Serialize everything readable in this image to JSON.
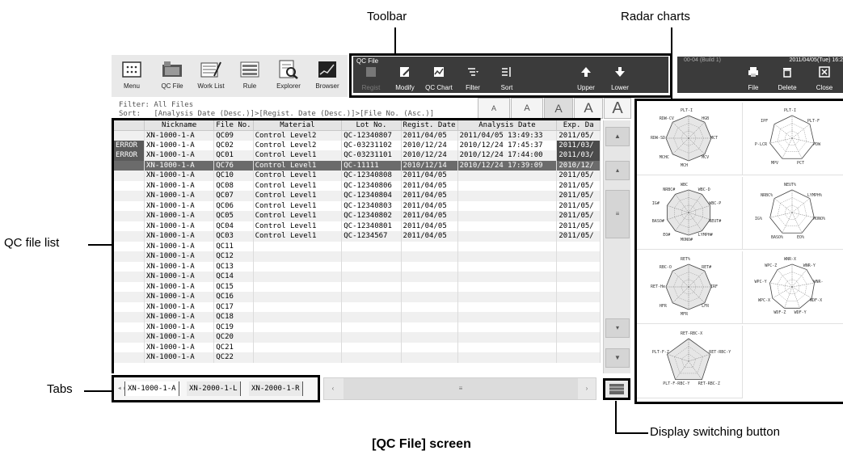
{
  "callouts": {
    "toolbar": "Toolbar",
    "radar_charts": "Radar charts",
    "qc_file_list": "QC file list",
    "tabs": "Tabs",
    "display_switching": "Display switching button"
  },
  "caption": "[QC File] screen",
  "appbar": {
    "items": [
      {
        "label": "Menu",
        "icon": "menu-icon"
      },
      {
        "label": "QC File",
        "icon": "qc-file-icon"
      },
      {
        "label": "Work List",
        "icon": "work-list-icon"
      },
      {
        "label": "Rule",
        "icon": "rule-icon"
      },
      {
        "label": "Explorer",
        "icon": "explorer-icon"
      },
      {
        "label": "Browser",
        "icon": "browser-icon"
      }
    ]
  },
  "toolbar": {
    "title": "QC File",
    "buttons": [
      {
        "label": "Regist",
        "icon": "edit-icon"
      },
      {
        "label": "Modify",
        "icon": "modify-icon"
      },
      {
        "label": "QC Chart",
        "icon": "qc-chart-icon"
      },
      {
        "label": "Filter",
        "icon": "filter-icon"
      },
      {
        "label": "Sort",
        "icon": "sort-icon"
      },
      {
        "label": "Upper",
        "icon": "arrow-up-icon"
      },
      {
        "label": "Lower",
        "icon": "arrow-down-icon"
      }
    ],
    "right": {
      "build": "00-04 (Build 1)",
      "datetime": "2011/04/05(Tue) 16:2",
      "buttons": [
        {
          "label": "File",
          "icon": "print-icon"
        },
        {
          "label": "Delete",
          "icon": "trash-icon"
        },
        {
          "label": "Close",
          "icon": "close-icon"
        }
      ]
    }
  },
  "filter": {
    "filter_line": "Filter: All Files",
    "sort_line": "Sort:   [Analysis Date (Desc.)]>[Regist. Date (Desc.)]>[File No. (Asc.)]",
    "font_sizes": [
      "A",
      "A",
      "A",
      "A",
      "A"
    ]
  },
  "table": {
    "columns": [
      "",
      "Nickname",
      "File No.",
      "Material",
      "Lot No.",
      "Regist. Date",
      "Analysis Date",
      "Exp. Da"
    ],
    "rows": [
      [
        "",
        "XN-1000-1-A",
        "QC09",
        "Control Level2",
        "QC-12340807",
        "2011/04/05",
        "2011/04/05 13:49:33",
        "2011/05/"
      ],
      [
        "ERROR",
        "XN-1000-1-A",
        "QC02",
        "Control Level2",
        "QC-03231102",
        "2010/12/24",
        "2010/12/24 17:45:37",
        "2011/03/"
      ],
      [
        "ERROR",
        "XN-1000-1-A",
        "QC01",
        "Control Level1",
        "QC-03231101",
        "2010/12/24",
        "2010/12/24 17:44:00",
        "2011/03/"
      ],
      [
        "",
        "XN-1000-1-A",
        "QC76",
        "Control Level1",
        "QC-11111",
        "2010/12/14",
        "2010/12/24 17:39:09",
        "2010/12/"
      ],
      [
        "",
        "XN-1000-1-A",
        "QC10",
        "Control Level1",
        "QC-12340808",
        "2011/04/05",
        "",
        "2011/05/"
      ],
      [
        "",
        "XN-1000-1-A",
        "QC08",
        "Control Level1",
        "QC-12340806",
        "2011/04/05",
        "",
        "2011/05/"
      ],
      [
        "",
        "XN-1000-1-A",
        "QC07",
        "Control Level1",
        "QC-12340804",
        "2011/04/05",
        "",
        "2011/05/"
      ],
      [
        "",
        "XN-1000-1-A",
        "QC06",
        "Control Level1",
        "QC-12340803",
        "2011/04/05",
        "",
        "2011/05/"
      ],
      [
        "",
        "XN-1000-1-A",
        "QC05",
        "Control Level1",
        "QC-12340802",
        "2011/04/05",
        "",
        "2011/05/"
      ],
      [
        "",
        "XN-1000-1-A",
        "QC04",
        "Control Level1",
        "QC-12340801",
        "2011/04/05",
        "",
        "2011/05/"
      ],
      [
        "",
        "XN-1000-1-A",
        "QC03",
        "Control Level1",
        "QC-1234567",
        "2011/04/05",
        "",
        "2011/05/"
      ],
      [
        "",
        "XN-1000-1-A",
        "QC11",
        "",
        "",
        "",
        "",
        ""
      ],
      [
        "",
        "XN-1000-1-A",
        "QC12",
        "",
        "",
        "",
        "",
        ""
      ],
      [
        "",
        "XN-1000-1-A",
        "QC13",
        "",
        "",
        "",
        "",
        ""
      ],
      [
        "",
        "XN-1000-1-A",
        "QC14",
        "",
        "",
        "",
        "",
        ""
      ],
      [
        "",
        "XN-1000-1-A",
        "QC15",
        "",
        "",
        "",
        "",
        ""
      ],
      [
        "",
        "XN-1000-1-A",
        "QC16",
        "",
        "",
        "",
        "",
        ""
      ],
      [
        "",
        "XN-1000-1-A",
        "QC17",
        "",
        "",
        "",
        "",
        ""
      ],
      [
        "",
        "XN-1000-1-A",
        "QC18",
        "",
        "",
        "",
        "",
        ""
      ],
      [
        "",
        "XN-1000-1-A",
        "QC19",
        "",
        "",
        "",
        "",
        ""
      ],
      [
        "",
        "XN-1000-1-A",
        "QC20",
        "",
        "",
        "",
        "",
        ""
      ],
      [
        "",
        "XN-1000-1-A",
        "QC21",
        "",
        "",
        "",
        "",
        ""
      ],
      [
        "",
        "XN-1000-1-A",
        "QC22",
        "",
        "",
        "",
        "",
        ""
      ]
    ],
    "selected_row": 3,
    "expired_rows": [
      1,
      2
    ]
  },
  "tabs": {
    "items": [
      "XN-1000-1-A",
      "XN-2000-1-L",
      "XN-2000-1-R"
    ]
  },
  "radar_charts": [
    {
      "axes": [
        "PLT-I",
        "HGB",
        "MCT",
        "MCV",
        "MCH",
        "MCHC",
        "RDW-SD",
        "RDW-CV"
      ]
    },
    {
      "axes": [
        "PLT-I",
        "PLT-F",
        "PDW",
        "PCT",
        "MPV",
        "P-LCR",
        "IPF"
      ]
    },
    {
      "axes": [
        "WBC",
        "WBC-D",
        "WBC-P",
        "NEUT#",
        "LYMPH#",
        "MONO#",
        "EO#",
        "BASO#",
        "IG#",
        "NRBC#"
      ]
    },
    {
      "axes": [
        "NEUT%",
        "LYMPH%",
        "MONO%",
        "EO%",
        "BASO%",
        "IG%",
        "NRBC%"
      ]
    },
    {
      "axes": [
        "RET%",
        "RET#",
        "IRF",
        "LFR",
        "MFR",
        "HFR",
        "RET-He",
        "RBC-O"
      ]
    },
    {
      "axes": [
        "WNR-X",
        "WNR-Y",
        "WNR-",
        "WDF-X",
        "WDF-Y",
        "WDF-Z",
        "WPC-X",
        "WPC-Y",
        "WPC-Z"
      ]
    },
    {
      "axes": [
        "RET-RBC-X",
        "RET-RBC-Y",
        "RET-RBC-Z",
        "PLT-F-RBC-Y",
        "PLT-F-Z"
      ]
    }
  ]
}
